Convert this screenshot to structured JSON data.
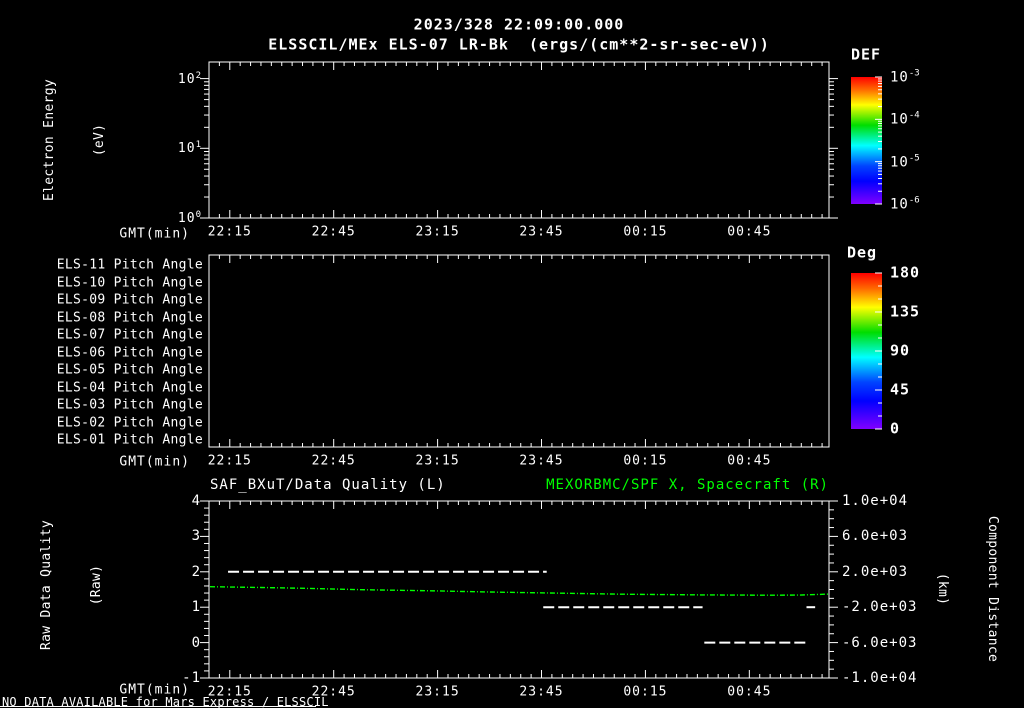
{
  "header": {
    "title": "2023/328 22:09:00.000",
    "subtitle": "ELSSCIL/MEx ELS-07 LR-Bk  (ergs/(cm**2-sr-sec-eV))"
  },
  "status_message": "NO DATA AVAILABLE for Mars Express / ELSSCIL",
  "colors": {
    "background": "#000000",
    "foreground": "#ffffff",
    "accent_green": "#00ff00",
    "colormap_rainbow": [
      "#ff0000",
      "#ff6a00",
      "#ffff00",
      "#00dd00",
      "#00ffff",
      "#0044ff",
      "#0000ff",
      "#8000ff"
    ]
  },
  "chart_data": [
    {
      "type": "heatmap",
      "name": "electron-energy-spectrogram",
      "ylabel": "Electron Energy (eV)",
      "ylabel_lines": [
        "Electron Energy",
        "(eV)"
      ],
      "yscale": "log",
      "ylim": [
        1,
        180
      ],
      "ytick_labels": [
        "10^2",
        "10^1",
        "10^0"
      ],
      "ytick_exponents": [
        2,
        1,
        0
      ],
      "xlabel": "GMT(min)",
      "xticks": [
        "22:15",
        "22:45",
        "23:15",
        "23:45",
        "00:15",
        "00:45"
      ],
      "xtick_minutes": [
        6,
        36,
        66,
        96,
        126,
        156
      ],
      "minor_tick_step_min": 3,
      "colorbar": {
        "label": "DEF",
        "scale": "log",
        "tick_labels": [
          "10^-3",
          "10^-4",
          "10^-5",
          "10^-6"
        ],
        "tick_exponents": [
          -3,
          -4,
          -5,
          -6
        ]
      },
      "values": [],
      "note": "panel empty - no data plotted"
    },
    {
      "type": "heatmap",
      "name": "pitch-angle-panels",
      "rows": [
        "ELS-11 Pitch Angle",
        "ELS-10 Pitch Angle",
        "ELS-09 Pitch Angle",
        "ELS-08 Pitch Angle",
        "ELS-07 Pitch Angle",
        "ELS-06 Pitch Angle",
        "ELS-05 Pitch Angle",
        "ELS-04 Pitch Angle",
        "ELS-03 Pitch Angle",
        "ELS-02 Pitch Angle",
        "ELS-01 Pitch Angle"
      ],
      "xlabel": "GMT(min)",
      "xticks": [
        "22:15",
        "22:45",
        "23:15",
        "23:45",
        "00:15",
        "00:45"
      ],
      "xtick_minutes": [
        6,
        36,
        66,
        96,
        126,
        156
      ],
      "minor_tick_step_min": 3,
      "colorbar": {
        "label": "Deg",
        "scale": "linear",
        "lim": [
          0,
          180
        ],
        "ticks": [
          180,
          135,
          90,
          45,
          0
        ],
        "minor_step": 15
      },
      "values": [],
      "note": "panel empty - no data plotted"
    },
    {
      "type": "line",
      "name": "quality-and-distance",
      "title_left": "SAF_BXuT/Data Quality (L)",
      "title_right": "MEXORBMC/SPF X, Spacecraft (R)",
      "ylabel_left": "Raw Data Quality (Raw)",
      "ylabel_left_lines": [
        "Raw Data Quality",
        "(Raw)"
      ],
      "ylim_left": [
        -1,
        4
      ],
      "yticks_left": [
        "4",
        "3",
        "2",
        "1",
        "0",
        "-1"
      ],
      "ytick_left_values": [
        4,
        3,
        2,
        1,
        0,
        -1
      ],
      "ylabel_right": "Component Distance (km)",
      "ylabel_right_lines": [
        "Component Distance",
        "(km)"
      ],
      "ylim_right": [
        -10000,
        10000
      ],
      "yticks_right": [
        "1.0e+04",
        "6.0e+03",
        "2.0e+03",
        "-2.0e+03",
        "-6.0e+03",
        "-1.0e+04"
      ],
      "ytick_right_values": [
        10000,
        6000,
        2000,
        -2000,
        -6000,
        -10000
      ],
      "xlabel": "GMT(min)",
      "xticks": [
        "22:15",
        "22:45",
        "23:15",
        "23:45",
        "00:15",
        "00:45"
      ],
      "xtick_minutes": [
        6,
        36,
        66,
        96,
        126,
        156
      ],
      "minor_tick_step_min": 3,
      "series": [
        {
          "name": "SAF_BXuT/Data Quality",
          "axis": "left",
          "color": "#ffffff",
          "style": "dashed",
          "segments": [
            {
              "value": 2,
              "t_range": [
                5.5,
                97.5
              ]
            },
            {
              "value": 1,
              "t_range": [
                96.5,
                142.5
              ]
            },
            {
              "value": 0,
              "t_range": [
                143,
                173
              ]
            },
            {
              "value": 1,
              "t_range": [
                172.5,
                175
              ]
            }
          ]
        },
        {
          "name": "MEXORBMC/SPF X Spacecraft",
          "axis": "right",
          "color": "#00ff00",
          "style": "dash-dot",
          "points_t_km": [
            [
              0.3,
              320
            ],
            [
              15,
              230
            ],
            [
              26,
              150
            ],
            [
              44,
              -20
            ],
            [
              64,
              -150
            ],
            [
              84,
              -300
            ],
            [
              102,
              -420
            ],
            [
              119,
              -530
            ],
            [
              142,
              -615
            ],
            [
              160,
              -645
            ],
            [
              170,
              -635
            ],
            [
              179,
              -520
            ]
          ]
        }
      ]
    }
  ]
}
